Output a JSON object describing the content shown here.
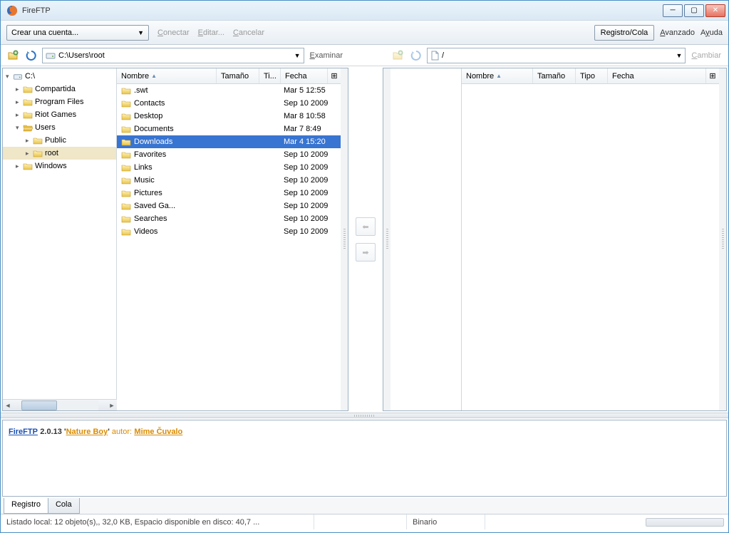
{
  "window": {
    "title": "FireFTP"
  },
  "toolbar": {
    "account_label": "Crear una cuenta...",
    "connect": "Conectar",
    "edit": "Editar...",
    "cancel": "Cancelar",
    "log_queue": "Registro/Cola",
    "advanced": "Avanzado",
    "help": "Ayuda"
  },
  "local": {
    "path": "C:\\Users\\root",
    "browse": "Examinar",
    "columns": {
      "name": "Nombre",
      "size": "Tamaño",
      "type": "Ti...",
      "date": "Fecha"
    },
    "tree": [
      {
        "label": "C:\\",
        "level": 0,
        "twisty": "▾",
        "icon": "drive"
      },
      {
        "label": "Compartida",
        "level": 1,
        "twisty": "▸",
        "icon": "folder"
      },
      {
        "label": "Program Files",
        "level": 1,
        "twisty": "▸",
        "icon": "folder"
      },
      {
        "label": "Riot Games",
        "level": 1,
        "twisty": "▸",
        "icon": "folder"
      },
      {
        "label": "Users",
        "level": 1,
        "twisty": "▾",
        "icon": "folder-open"
      },
      {
        "label": "Public",
        "level": 2,
        "twisty": "▸",
        "icon": "folder"
      },
      {
        "label": "root",
        "level": 2,
        "twisty": "▸",
        "icon": "folder",
        "selected": true
      },
      {
        "label": "Windows",
        "level": 1,
        "twisty": "▸",
        "icon": "folder"
      }
    ],
    "files": [
      {
        "name": ".swt",
        "size": "",
        "type": "",
        "date": "Mar 5 12:55"
      },
      {
        "name": "Contacts",
        "size": "",
        "type": "",
        "date": "Sep 10 2009"
      },
      {
        "name": "Desktop",
        "size": "",
        "type": "",
        "date": "Mar 8 10:58"
      },
      {
        "name": "Documents",
        "size": "",
        "type": "",
        "date": "Mar 7 8:49"
      },
      {
        "name": "Downloads",
        "size": "",
        "type": "",
        "date": "Mar 4 15:20",
        "selected": true
      },
      {
        "name": "Favorites",
        "size": "",
        "type": "",
        "date": "Sep 10 2009"
      },
      {
        "name": "Links",
        "size": "",
        "type": "",
        "date": "Sep 10 2009"
      },
      {
        "name": "Music",
        "size": "",
        "type": "",
        "date": "Sep 10 2009"
      },
      {
        "name": "Pictures",
        "size": "",
        "type": "",
        "date": "Sep 10 2009"
      },
      {
        "name": "Saved Ga...",
        "size": "",
        "type": "",
        "date": "Sep 10 2009"
      },
      {
        "name": "Searches",
        "size": "",
        "type": "",
        "date": "Sep 10 2009"
      },
      {
        "name": "Videos",
        "size": "",
        "type": "",
        "date": "Sep 10 2009"
      }
    ]
  },
  "remote": {
    "path": "/",
    "change": "Cambiar",
    "columns": {
      "name": "Nombre",
      "size": "Tamaño",
      "type": "Tipo",
      "date": "Fecha"
    },
    "files": []
  },
  "log": {
    "product": "FireFTP",
    "version": "2.0.13",
    "codename": "Nature Boy",
    "author_label": "autor:",
    "author": "Mime Čuvalo",
    "tabs": {
      "registro": "Registro",
      "cola": "Cola"
    }
  },
  "status": {
    "main": "Listado local: 12 objeto(s),, 32,0 KB, Espacio disponible en disco: 40,7 ...",
    "mode": "Binario"
  }
}
